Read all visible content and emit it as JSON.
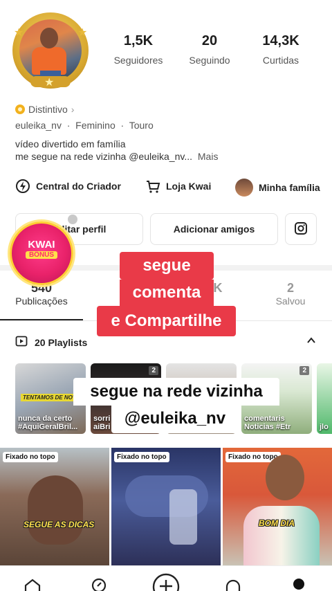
{
  "profile": {
    "stats": [
      {
        "value": "1,5K",
        "label": "Seguidores"
      },
      {
        "value": "20",
        "label": "Seguindo"
      },
      {
        "value": "14,3K",
        "label": "Curtidas"
      }
    ],
    "badge_label": "Distintivo",
    "meta": "euleika_nv  ·  Feminino  ·  Touro",
    "bio_line1": "vídeo divertido em família",
    "bio_line2": "me segue na rede vizinha @euleika_nv...",
    "bio_more": "Mais"
  },
  "shortcuts": [
    {
      "label": "Central do Criador",
      "icon": "bolt-icon"
    },
    {
      "label": "Loja Kwai",
      "icon": "cart-icon"
    },
    {
      "label": "Minha família",
      "icon": "family-avatar"
    }
  ],
  "actions": {
    "edit": "Editar perfil",
    "add_friends": "Adicionar amigos",
    "instagram_icon": "instagram-icon"
  },
  "tabs": [
    {
      "count": "540",
      "label": "Publicações"
    },
    {
      "count": "K",
      "label": ""
    },
    {
      "count": "2",
      "label": "Salvou"
    }
  ],
  "playlists": {
    "label": "20 Playlists",
    "items": [
      {
        "caption": "nunca da certo #AquiGeralBril...",
        "badge": "",
        "tag": "TENTAMOS DE NOVO"
      },
      {
        "caption": "sorri aiBri",
        "badge": "2",
        "tag": ""
      },
      {
        "caption": "",
        "badge": "",
        "tag": ""
      },
      {
        "caption": "comentaris Noticias #Etr",
        "badge": "2",
        "tag": ""
      },
      {
        "caption": "jlo",
        "badge": "",
        "tag": ""
      }
    ]
  },
  "grid": [
    {
      "pin": "Fixado no topo",
      "tag": "SEGUE AS DICAS"
    },
    {
      "pin": "Fixado no topo",
      "tag": ""
    },
    {
      "pin": "Fixado no topo",
      "tag": "BOM DIA"
    }
  ],
  "overlays": {
    "kwai_line1": "KWAI",
    "kwai_line2": "BÔNUS",
    "red_line1": "segue",
    "red_line2": "comenta",
    "red_line3": "e Compartilhe",
    "white_line1": "segue na rede vizinha",
    "white_line2": "@euleika_nv"
  },
  "nav_icons": [
    "home-icon",
    "explore-icon",
    "plus-icon",
    "message-icon",
    "profile-icon"
  ],
  "colors": {
    "accent_red": "#e93a48",
    "gold": "#d9a931",
    "kwai_pink": "#e9226a"
  }
}
